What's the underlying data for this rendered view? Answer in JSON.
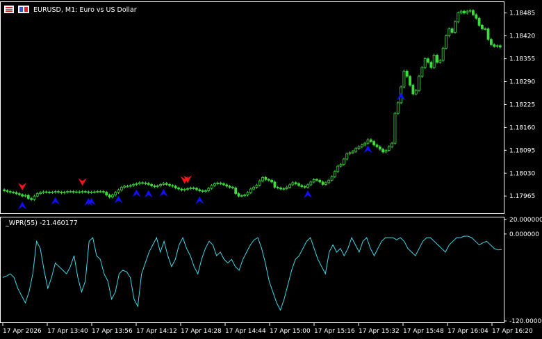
{
  "header": {
    "symbol_title": "EURUSD, M1:  Euro vs US Dollar",
    "icons": [
      "chart-window-icon",
      "one-click-trading-icon"
    ]
  },
  "indicator": {
    "title": "_WPR(55) -21.460177"
  },
  "colors": {
    "background": "#000000",
    "frame": "#ffffff",
    "candle": "#3cdc3c",
    "wpr_line": "#40d8e8",
    "arrow_buy": "#1010ff",
    "arrow_sell": "#ff1414"
  },
  "chart_data": [
    {
      "type": "candlestick",
      "title": "EURUSD, M1:  Euro vs US Dollar",
      "y_tick_labels": [
        "1.18485",
        "1.18420",
        "1.18355",
        "1.18290",
        "1.18225",
        "1.18160",
        "1.18095",
        "1.18030",
        "1.17965"
      ],
      "ylim": [
        1.1792,
        1.1851
      ],
      "x_tick_labels": [
        "17 Apr 2026",
        "17 Apr 13:40",
        "17 Apr 13:56",
        "17 Apr 14:12",
        "17 Apr 14:28",
        "17 Apr 14:44",
        "17 Apr 15:00",
        "17 Apr 15:16",
        "17 Apr 15:32",
        "17 Apr 15:48",
        "17 Apr 16:04",
        "17 Apr 16:20"
      ],
      "close": [
        1.1798,
        1.17978,
        1.17976,
        1.17975,
        1.17972,
        1.17969,
        1.17965,
        1.17967,
        1.17958,
        1.17955,
        1.17965,
        1.17972,
        1.17975,
        1.17977,
        1.17976,
        1.17975,
        1.17976,
        1.17978,
        1.17976,
        1.17974,
        1.17976,
        1.17978,
        1.17978,
        1.17976,
        1.17977,
        1.17976,
        1.17978,
        1.17977,
        1.17975,
        1.17976,
        1.17977,
        1.17978,
        1.17978,
        1.17976,
        1.17968,
        1.17962,
        1.17968,
        1.17975,
        1.17982,
        1.1799,
        1.17993,
        1.17993,
        1.17995,
        1.17998,
        1.18,
        1.18003,
        1.18002,
        1.18001,
        1.17998,
        1.17994,
        1.17992,
        1.17994,
        1.17998,
        1.18001,
        1.17998,
        1.17995,
        1.17993,
        1.17988,
        1.17985,
        1.17982,
        1.17984,
        1.17986,
        1.17988,
        1.17987,
        1.17983,
        1.1798,
        1.17978,
        1.1798,
        1.17987,
        1.17995,
        1.18,
        1.18002,
        1.18,
        1.17997,
        1.17993,
        1.1799,
        1.17988,
        1.17972,
        1.17965,
        1.17966,
        1.17968,
        1.17975,
        1.17985,
        1.1799,
        1.17996,
        1.18008,
        1.18018,
        1.18012,
        1.1801,
        1.18005,
        1.1799,
        1.17988,
        1.17985,
        1.17986,
        1.1799,
        1.17997,
        1.18003,
        1.18,
        1.17995,
        1.17992,
        1.1799,
        1.17997,
        1.18005,
        1.18012,
        1.1801,
        1.18005,
        1.17998,
        1.18003,
        1.1801,
        1.1802,
        1.18035,
        1.1805,
        1.18055,
        1.1807,
        1.18085,
        1.18088,
        1.18092,
        1.181,
        1.18105,
        1.1811,
        1.18115,
        1.18125,
        1.1812,
        1.1811,
        1.18105,
        1.18098,
        1.1809,
        1.18095,
        1.18105,
        1.18115,
        1.182,
        1.1823,
        1.18275,
        1.1832,
        1.18305,
        1.1828,
        1.18255,
        1.18265,
        1.18305,
        1.1833,
        1.18355,
        1.18345,
        1.1833,
        1.18365,
        1.18345,
        1.1835,
        1.18385,
        1.1842,
        1.1844,
        1.1843,
        1.1846,
        1.18485,
        1.1849,
        1.18485,
        1.1849,
        1.18492,
        1.1848,
        1.1847,
        1.1845,
        1.1844,
        1.1844,
        1.1841,
        1.18395,
        1.1839,
        1.18392,
        1.18388
      ],
      "series": [
        {
          "name": "_WPR(55)",
          "ylim": [
            -120,
            20
          ],
          "y_tick_labels": [
            "20.000000",
            "0.000000",
            "-120.000000"
          ],
          "values": [
            -60,
            -58,
            -55,
            -60,
            -75,
            -85,
            -95,
            -80,
            -55,
            -10,
            -20,
            -50,
            -75,
            -60,
            -40,
            -45,
            -50,
            -55,
            -45,
            -30,
            -60,
            -80,
            -65,
            -10,
            -5,
            -30,
            -35,
            -55,
            -65,
            -90,
            -80,
            -55,
            -50,
            -52,
            -60,
            -90,
            -100,
            -55,
            -40,
            -25,
            -15,
            -5,
            -25,
            -10,
            -30,
            -45,
            -35,
            -15,
            -5,
            -20,
            -30,
            -45,
            -55,
            -35,
            -20,
            -10,
            -15,
            -30,
            -25,
            -35,
            -40,
            -35,
            -45,
            -50,
            -35,
            -25,
            -15,
            -8,
            -5,
            -20,
            -40,
            -65,
            -80,
            -95,
            -105,
            -90,
            -70,
            -50,
            -35,
            -30,
            -20,
            -10,
            -5,
            -20,
            -35,
            -45,
            -55,
            -25,
            -15,
            -25,
            -20,
            -30,
            -20,
            -5,
            -15,
            -25,
            -10,
            -5,
            -20,
            -30,
            -20,
            -10,
            -5,
            -5,
            -5,
            -8,
            -5,
            -10,
            -20,
            -25,
            -30,
            -20,
            -10,
            -5,
            -5,
            -10,
            -15,
            -20,
            -25,
            -15,
            -10,
            -5,
            -5,
            -3,
            -3,
            -5,
            -10,
            -15,
            -12,
            -10,
            -15,
            -20,
            -22,
            -21.46
          ]
        }
      ],
      "buy_arrows": [
        6,
        17,
        28,
        29,
        38,
        44,
        48,
        53,
        65,
        101,
        121,
        132
      ],
      "sell_arrows": [
        6,
        26,
        60,
        61
      ]
    }
  ]
}
